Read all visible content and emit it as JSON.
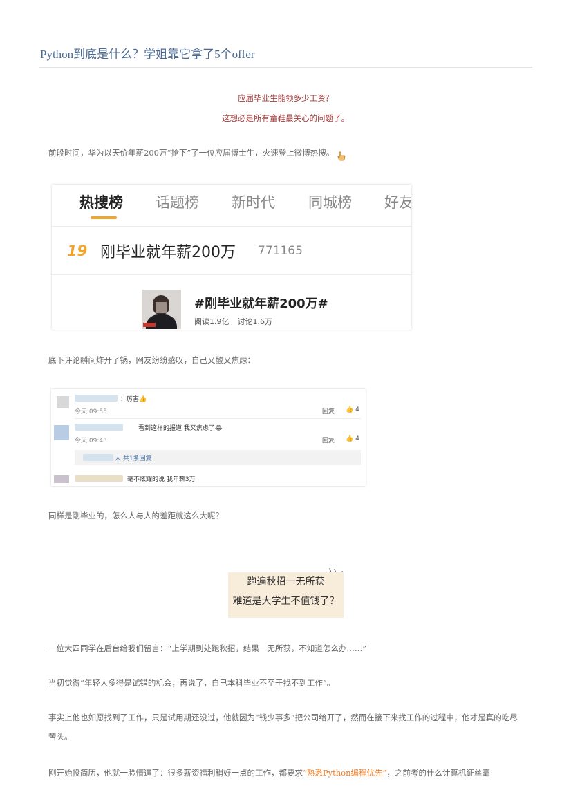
{
  "article": {
    "title": "Python到底是什么？学姐靠它拿了5个offer",
    "intro_line1": "应届毕业生能领多少工资？",
    "intro_line2": "这想必是所有童鞋最关心的问题了。",
    "p1": "前段时间，华为以天价年薪200万“抢下”了一位应届博士生，火速登上微博热搜。",
    "p1_emoji": "pointing-hand-icon",
    "p2": "底下评论瞬间炸开了锅，网友纷纷感叹，自己又酸又焦虑：",
    "p3": "同样是刚毕业的，怎么人与人的差距就这么大呢？",
    "quote_line1": "跑遍秋招一无所获",
    "quote_line2": "难道是大学生不值钱了？",
    "p4": "一位大四同学在后台给我们留言：“上学期到处跑秋招，结果一无所获，不知道怎么办……”",
    "p5": "当初觉得“年轻人多得是试错的机会，再说了，自己本科毕业不至于找不到工作”。",
    "p6": "事实上他也如愿找到了工作，只是试用期还没过，他就因为“钱少事多”把公司给开了，然而在接下来找工作的过程中，他才是真的吃尽苦头。",
    "p7_before": "刚开始投简历，他就一脸懵逼了：很多薪资福利稍好一点的工作，都要求",
    "p7_highlight": "“熟悉Python编程优先”",
    "p7_after": "，之前考的什么计算机证丝毫",
    "highlight_color": "#ee7a22"
  },
  "hot_search": {
    "tabs": [
      "热搜榜",
      "话题榜",
      "新时代",
      "同城榜",
      "好友"
    ],
    "active_tab": "热搜榜",
    "rank": "19",
    "headline": "刚毕业就年薪200万",
    "heat": "771165",
    "topic": "#刚毕业就年薪200万#",
    "reads": "阅读1.9亿",
    "discussions": "讨论1.6万"
  },
  "comments": {
    "c1_text": "：厉害👍",
    "c1_time": "今天 09:55",
    "c2_text": "看到这样的报道 我又焦虑了😂",
    "c2_time": "今天 09:43",
    "reply_label": "回复",
    "like_count": "4",
    "reply_summary": "人 共1条回复",
    "c3_text": "毫不炫耀的说 我年薪3万"
  }
}
